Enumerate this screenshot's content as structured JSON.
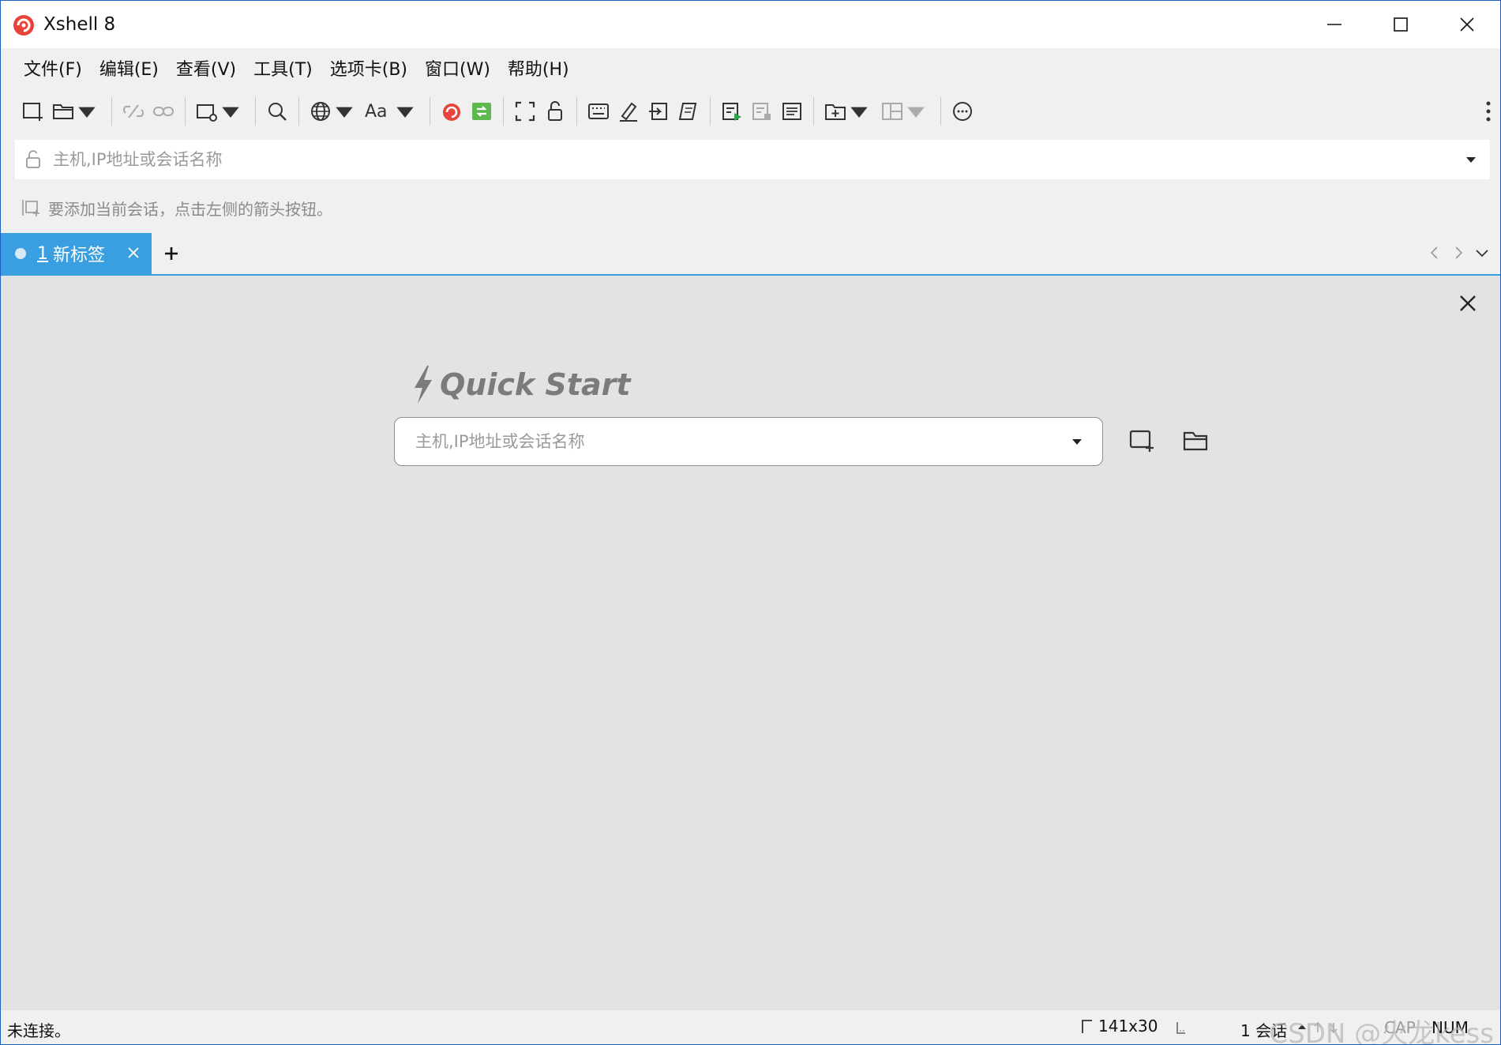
{
  "window": {
    "title": "Xshell 8",
    "accent_color": "#3a9fe0",
    "icons": [
      "app-logo-icon",
      "minimize-icon",
      "maximize-icon",
      "close-icon"
    ]
  },
  "menubar": {
    "items": [
      "文件(F)",
      "编辑(E)",
      "查看(V)",
      "工具(T)",
      "选项卡(B)",
      "窗口(W)",
      "帮助(H)"
    ]
  },
  "toolbar": {
    "icons": [
      "new-session-icon",
      "open-session-icon",
      "disconnect-icon",
      "reconnect-icon",
      "new-tab-icon",
      "find-icon",
      "encoding-icon",
      "font-icon",
      "xshell-icon",
      "xftp-icon",
      "fullscreen-icon",
      "lock-icon",
      "compose-bar-icon",
      "highlight-icon",
      "transfer-icon",
      "script-icon",
      "start-logging-icon",
      "stop-logging-icon",
      "log-icon",
      "add-icon",
      "layout-icon",
      "chat-icon",
      "more-icon"
    ],
    "font_label": "Aa"
  },
  "addressbar": {
    "placeholder": "主机,IP地址或会话名称"
  },
  "hintbar": {
    "text": "要添加当前会话，点击左侧的箭头按钮。"
  },
  "tabs": {
    "items": [
      {
        "number": "1",
        "label": "新标签",
        "active": true
      }
    ],
    "add_symbol": "+"
  },
  "quickstart": {
    "title": "Quick Start",
    "placeholder": "主机,IP地址或会话名称"
  },
  "statusbar": {
    "connection": "未连接。",
    "size": "141x30",
    "sessions": "1 会话",
    "cap": "CAP",
    "num": "NUM",
    "watermark": "CSDN @火龙kess"
  }
}
